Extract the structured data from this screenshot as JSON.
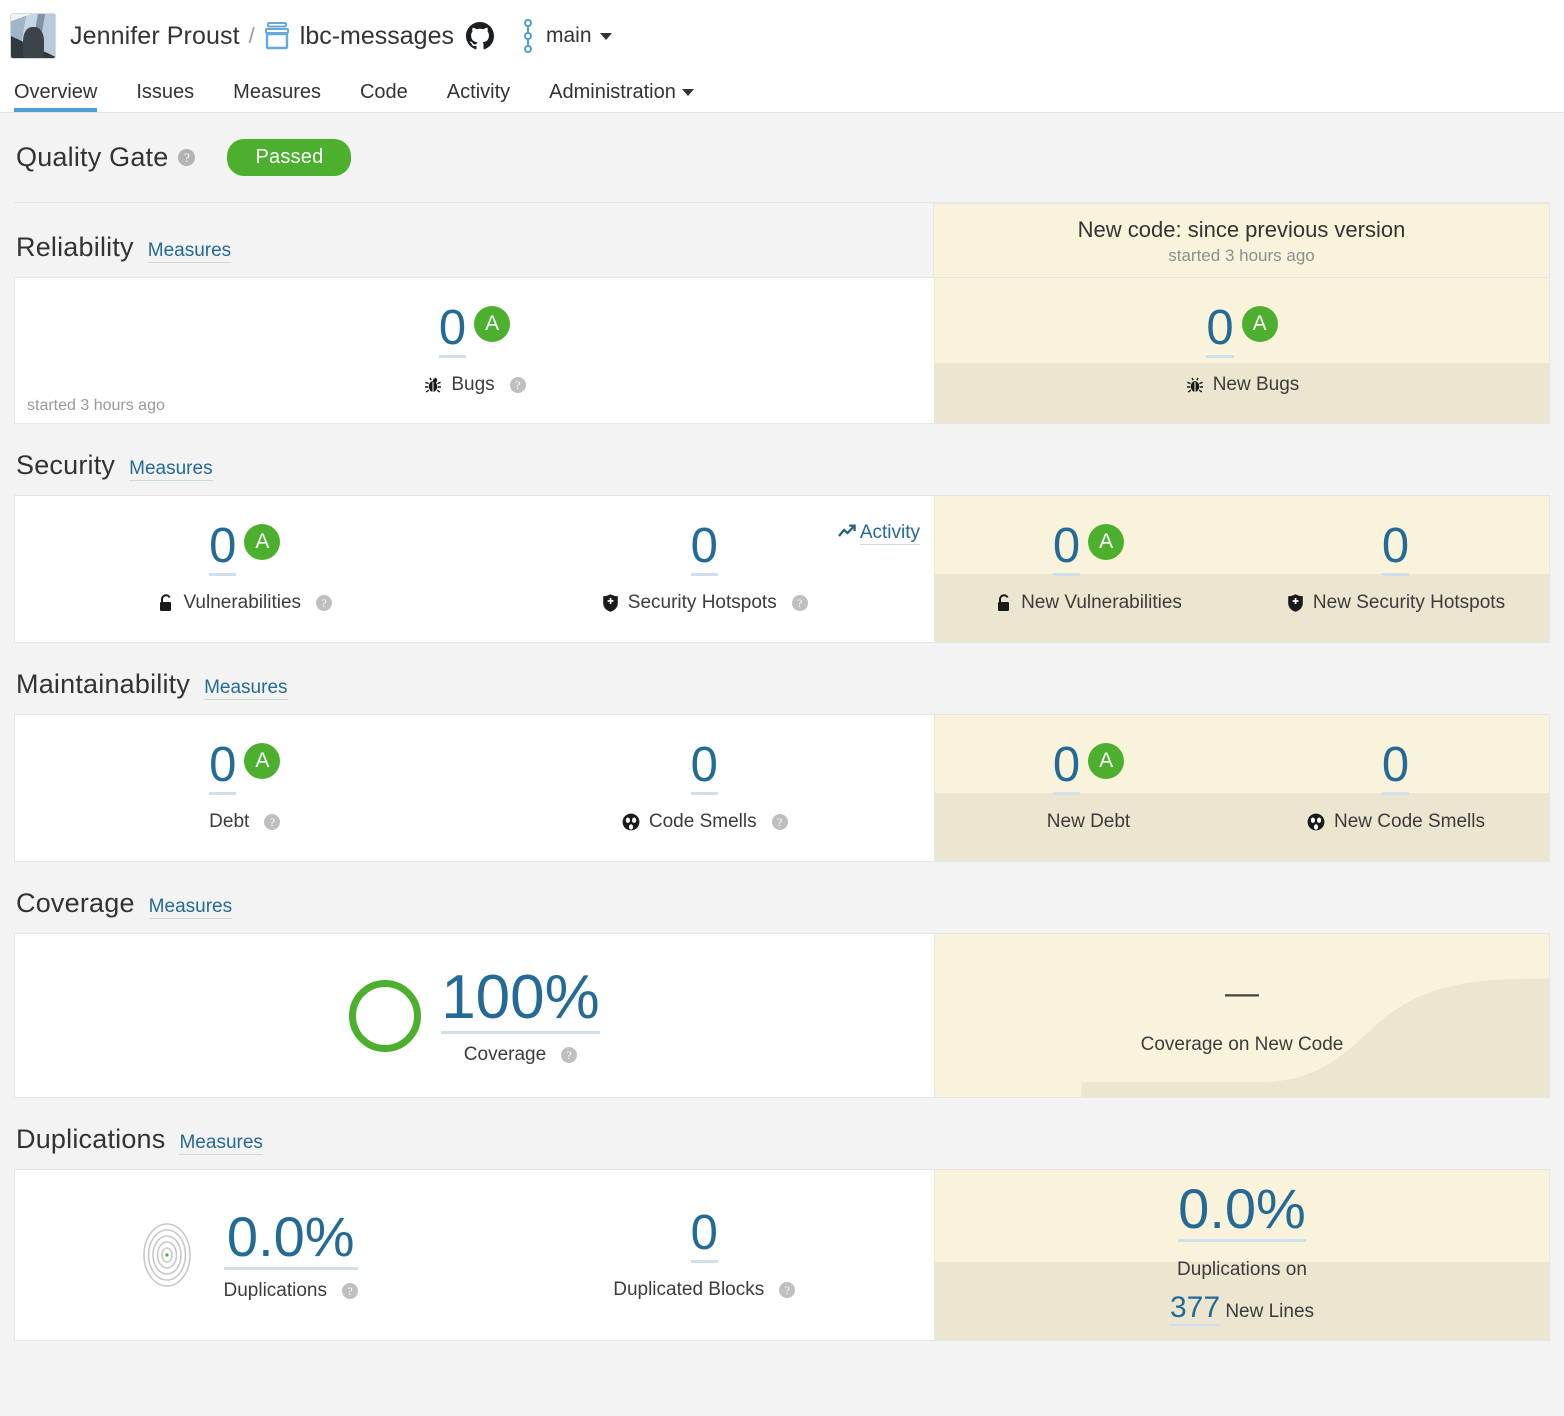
{
  "header": {
    "user": "Jennifer Proust",
    "separator": "/",
    "project": "lbc-messages",
    "branch": "main",
    "icons": {
      "avatar": "user-avatar",
      "project": "project-icon",
      "vcs": "github-icon",
      "branch": "branch-icon"
    }
  },
  "tabs": [
    {
      "label": "Overview",
      "active": true
    },
    {
      "label": "Issues",
      "active": false
    },
    {
      "label": "Measures",
      "active": false
    },
    {
      "label": "Code",
      "active": false
    },
    {
      "label": "Activity",
      "active": false
    },
    {
      "label": "Administration",
      "active": false,
      "has_caret": true
    }
  ],
  "quality_gate": {
    "title": "Quality Gate",
    "help": "?",
    "status": "Passed",
    "status_color": "#4caf2e"
  },
  "new_code": {
    "title": "New code: since previous version",
    "subtitle": "started 3 hours ago",
    "bg": "#faf3dc",
    "bg_shade": "#ece5d0"
  },
  "measures_link": "Measures",
  "activity_link": "Activity",
  "sections": {
    "reliability": {
      "title": "Reliability",
      "started": "started 3 hours ago",
      "overall": [
        {
          "value": "0",
          "label": "Bugs",
          "rating": "A",
          "icon": "bug-icon",
          "help": true
        }
      ],
      "new": [
        {
          "value": "0",
          "label": "New Bugs",
          "rating": "A",
          "icon": "bug-icon",
          "help": false
        }
      ]
    },
    "security": {
      "title": "Security",
      "overall": [
        {
          "value": "0",
          "label": "Vulnerabilities",
          "rating": "A",
          "icon": "lock-icon",
          "help": true
        },
        {
          "value": "0",
          "label": "Security Hotspots",
          "rating": null,
          "icon": "shield-icon",
          "help": true
        }
      ],
      "new": [
        {
          "value": "0",
          "label": "New Vulnerabilities",
          "rating": "A",
          "icon": "lock-icon",
          "help": false
        },
        {
          "value": "0",
          "label": "New Security Hotspots",
          "rating": null,
          "icon": "shield-icon",
          "help": false
        }
      ]
    },
    "maintainability": {
      "title": "Maintainability",
      "overall": [
        {
          "value": "0",
          "label": "Debt",
          "rating": "A",
          "icon": null,
          "help": true
        },
        {
          "value": "0",
          "label": "Code Smells",
          "rating": null,
          "icon": "code-smell-icon",
          "help": true
        }
      ],
      "new": [
        {
          "value": "0",
          "label": "New Debt",
          "rating": "A",
          "icon": null,
          "help": false
        },
        {
          "value": "0",
          "label": "New Code Smells",
          "rating": null,
          "icon": "code-smell-icon",
          "help": false
        }
      ]
    },
    "coverage": {
      "title": "Coverage",
      "overall": {
        "value": "100%",
        "label": "Coverage",
        "ring_color": "#4caf2e",
        "help": true
      },
      "new": {
        "value": "—",
        "label": "Coverage on New Code"
      }
    },
    "duplications": {
      "title": "Duplications",
      "overall": [
        {
          "value": "0.0%",
          "label": "Duplications",
          "icon": "duplication-rings-icon",
          "help": true
        },
        {
          "value": "0",
          "label": "Duplicated Blocks",
          "icon": null,
          "help": true
        }
      ],
      "new": {
        "value": "0.0%",
        "label_1": "Duplications on",
        "lines": "377",
        "label_2": "New Lines"
      }
    }
  },
  "colors": {
    "accent_blue": "#4b9fd5",
    "link_blue": "#236a97",
    "rating_green": "#4caf2e",
    "new_code_yellow": "#faf3dc",
    "page_bg": "#f3f3f3"
  }
}
